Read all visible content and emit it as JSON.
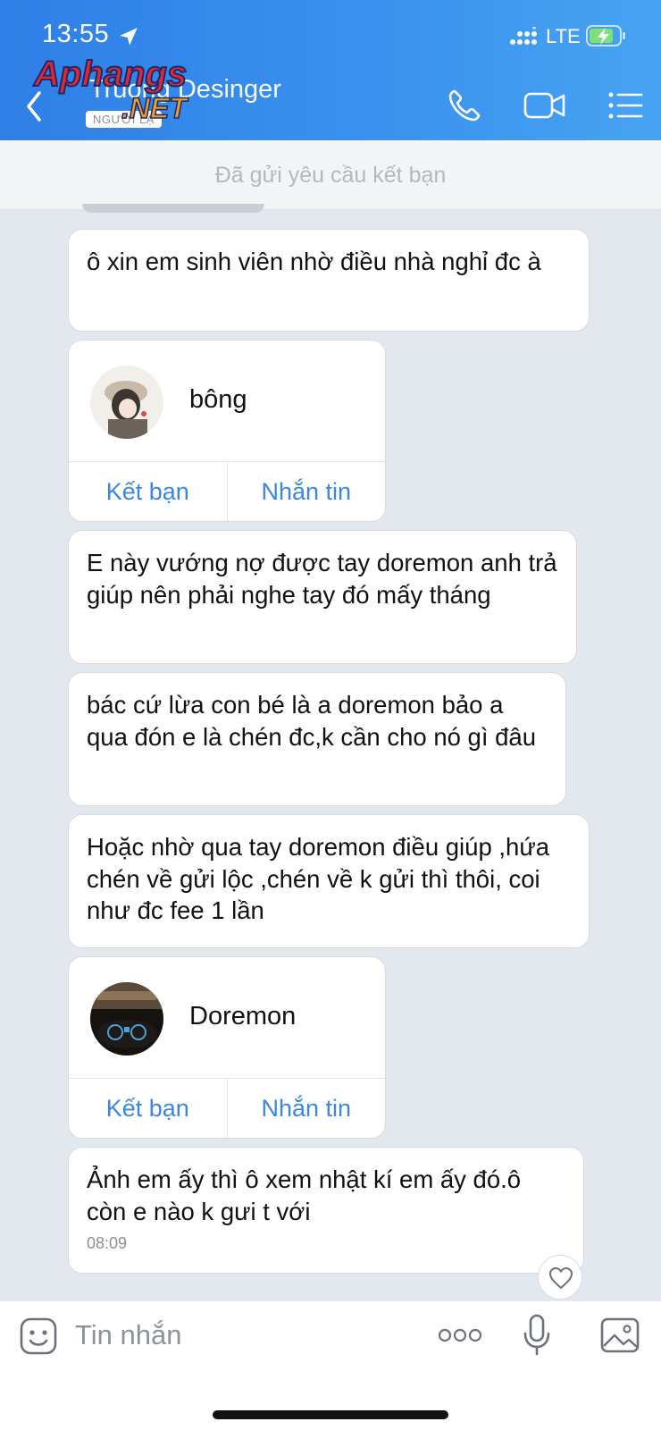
{
  "status_bar": {
    "time": "13:55",
    "network": "LTE"
  },
  "header": {
    "contact_name": "Truong Desinger",
    "badge": "NGƯỜI LẠ",
    "watermark": {
      "top": "Aphangs",
      "bottom": ".NET"
    }
  },
  "friend_request_banner": "Đã gửi yêu cầu kết bạn",
  "messages": [
    {
      "type": "text",
      "text": "ô xin em sinh viên nhờ điều nhà nghỉ đc à"
    },
    {
      "type": "contact_card",
      "name": "bông",
      "add_friend": "Kết bạn",
      "message": "Nhắn tin"
    },
    {
      "type": "text",
      "text": "E này vướng nợ được tay doremon anh trả giúp nên phải nghe tay đó mấy tháng"
    },
    {
      "type": "text",
      "text": "bác cứ lừa con bé là a doremon bảo a qua đón e là chén đc,k cần cho nó gì đâu"
    },
    {
      "type": "text",
      "text": "Hoặc nhờ qua tay doremon điều giúp ,hứa chén về gửi lộc ,chén về k gửi thì thôi, coi như đc fee 1 lần"
    },
    {
      "type": "contact_card",
      "name": "Doremon",
      "add_friend": "Kết bạn",
      "message": "Nhắn tin"
    },
    {
      "type": "text",
      "text": "Ảnh em ấy thì ô xem nhật kí em ấy đó.ô còn e nào k gưi t với",
      "time": "08:09"
    }
  ],
  "composer": {
    "placeholder": "Tin nhắn"
  },
  "colors": {
    "header_blue": "#3b8cec",
    "link_blue": "#3b87e0",
    "chat_bg": "#e3e7ee"
  }
}
